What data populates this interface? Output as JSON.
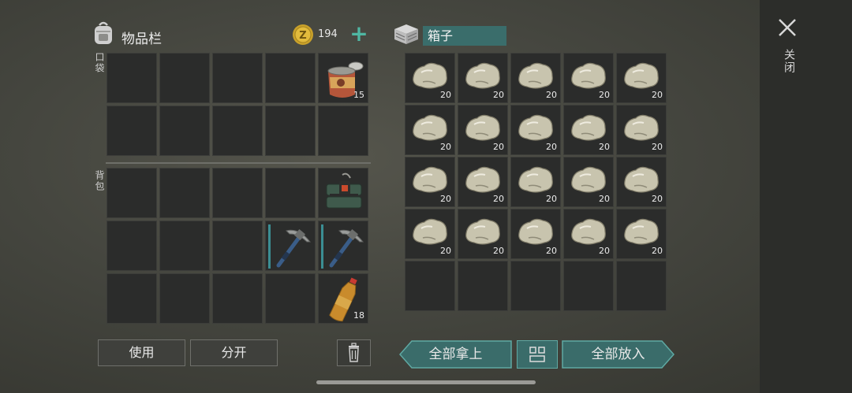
{
  "inventory": {
    "title": "物品栏",
    "coins": "194",
    "pocket_label": "口袋",
    "backpack_label": "背包",
    "pocket_slots": [
      {
        "item": "",
        "count": ""
      },
      {
        "item": "",
        "count": ""
      },
      {
        "item": "",
        "count": ""
      },
      {
        "item": "",
        "count": ""
      },
      {
        "item": "canned-food",
        "count": "15"
      },
      {
        "item": "",
        "count": ""
      },
      {
        "item": "",
        "count": ""
      },
      {
        "item": "",
        "count": ""
      },
      {
        "item": "",
        "count": ""
      },
      {
        "item": "",
        "count": ""
      }
    ],
    "backpack_slots": [
      {
        "item": "",
        "count": ""
      },
      {
        "item": "",
        "count": ""
      },
      {
        "item": "",
        "count": ""
      },
      {
        "item": "",
        "count": ""
      },
      {
        "item": "explosive-charge",
        "count": ""
      },
      {
        "item": "",
        "count": ""
      },
      {
        "item": "",
        "count": ""
      },
      {
        "item": "",
        "count": ""
      },
      {
        "item": "pickaxe",
        "count": ""
      },
      {
        "item": "pickaxe",
        "count": ""
      },
      {
        "item": "",
        "count": ""
      },
      {
        "item": "",
        "count": ""
      },
      {
        "item": "",
        "count": ""
      },
      {
        "item": "",
        "count": ""
      },
      {
        "item": "water-bottle",
        "count": "18"
      }
    ],
    "use_label": "使用",
    "split_label": "分开"
  },
  "box": {
    "title": "箱子",
    "slots": [
      {
        "item": "stone",
        "count": "20"
      },
      {
        "item": "stone",
        "count": "20"
      },
      {
        "item": "stone",
        "count": "20"
      },
      {
        "item": "stone",
        "count": "20"
      },
      {
        "item": "stone",
        "count": "20"
      },
      {
        "item": "stone",
        "count": "20"
      },
      {
        "item": "stone",
        "count": "20"
      },
      {
        "item": "stone",
        "count": "20"
      },
      {
        "item": "stone",
        "count": "20"
      },
      {
        "item": "stone",
        "count": "20"
      },
      {
        "item": "stone",
        "count": "20"
      },
      {
        "item": "stone",
        "count": "20"
      },
      {
        "item": "stone",
        "count": "20"
      },
      {
        "item": "stone",
        "count": "20"
      },
      {
        "item": "stone",
        "count": "20"
      },
      {
        "item": "stone",
        "count": "20"
      },
      {
        "item": "stone",
        "count": "20"
      },
      {
        "item": "stone",
        "count": "20"
      },
      {
        "item": "stone",
        "count": "20"
      },
      {
        "item": "stone",
        "count": "20"
      },
      {
        "item": "",
        "count": ""
      },
      {
        "item": "",
        "count": ""
      },
      {
        "item": "",
        "count": ""
      },
      {
        "item": "",
        "count": ""
      },
      {
        "item": "",
        "count": ""
      }
    ],
    "take_all_label": "全部拿上",
    "put_all_label": "全部放入"
  },
  "close_label": "关闭",
  "colors": {
    "accent": "#4fb7a3",
    "box_name_bg": "#3a6d6b",
    "slot_bg": "#2b2c2b"
  }
}
